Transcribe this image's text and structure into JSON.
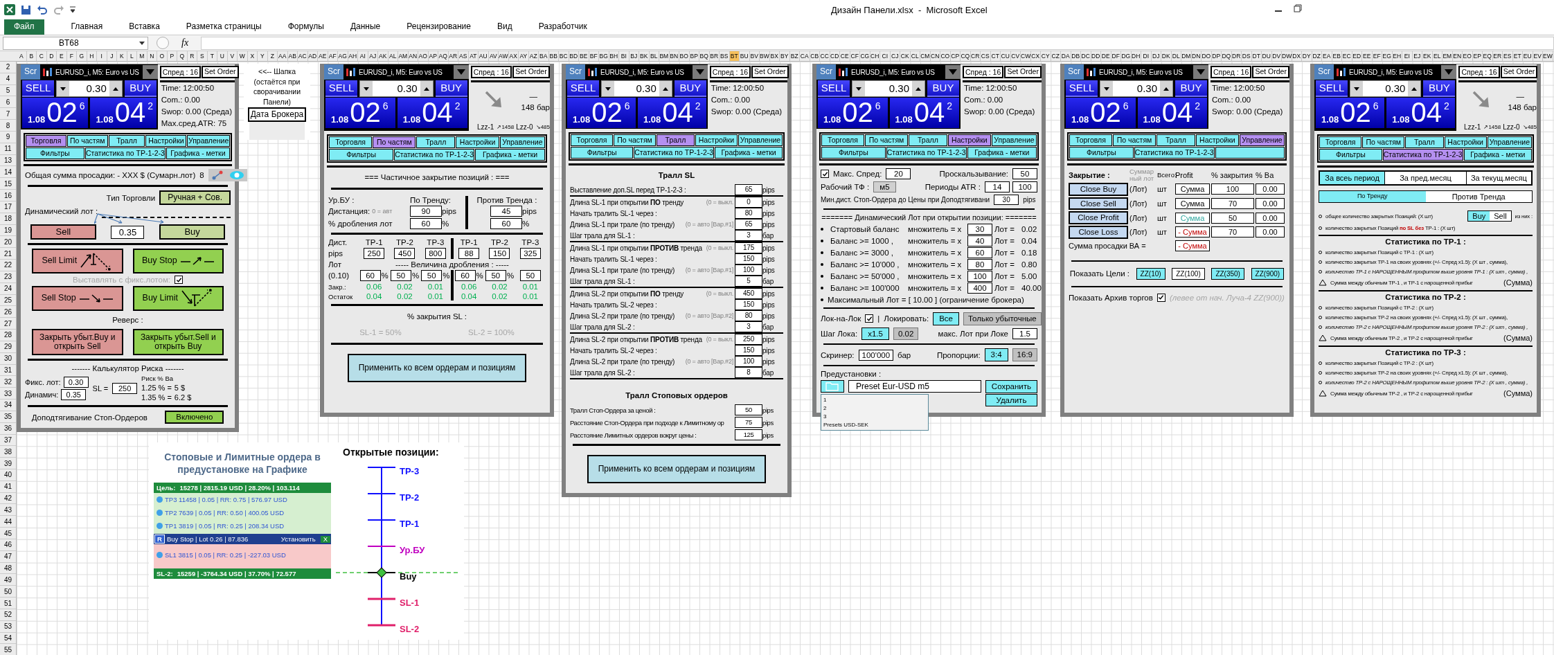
{
  "titlebar": {
    "title": "Дизайн Панели.xlsx  -  Microsoft Excel"
  },
  "ribbon": {
    "file_tab": "Файл",
    "tabs": [
      "Главная",
      "Вставка",
      "Разметка страницы",
      "Формулы",
      "Данные",
      "Рецензирование",
      "Вид",
      "Разработчик"
    ]
  },
  "formula_bar": {
    "name_box": "BT68",
    "fx": "fx"
  },
  "sheet": {
    "columns": [
      {
        "label": "A",
        "selected": false
      },
      {
        "label": "B",
        "selected": false
      },
      {
        "label": "C",
        "selected": false
      },
      {
        "label": "D",
        "selected": false
      },
      {
        "label": "E",
        "selected": false
      },
      {
        "label": "F",
        "selected": false
      },
      {
        "label": "G",
        "selected": false
      },
      {
        "label": "H",
        "selected": false
      },
      {
        "label": "I",
        "selected": false
      },
      {
        "label": "J",
        "selected": false
      },
      {
        "label": "K",
        "selected": false
      },
      {
        "label": "L",
        "selected": false
      },
      {
        "label": "M",
        "selected": false
      },
      {
        "label": "N",
        "selected": false
      },
      {
        "label": "O",
        "selected": false
      },
      {
        "label": "P",
        "selected": false
      },
      {
        "label": "Q",
        "selected": false
      },
      {
        "label": "R",
        "selected": false
      },
      {
        "label": "S",
        "selected": false
      },
      {
        "label": "T",
        "selected": false
      },
      {
        "label": "U",
        "selected": false
      },
      {
        "label": "V",
        "selected": false
      },
      {
        "label": "W",
        "selected": false
      },
      {
        "label": "X",
        "selected": false
      },
      {
        "label": "Y",
        "selected": false
      },
      {
        "label": "Z",
        "selected": false
      },
      {
        "label": "AA",
        "selected": false
      },
      {
        "label": "AB",
        "selected": false
      },
      {
        "label": "AC",
        "selected": false
      },
      {
        "label": "AD",
        "selected": false
      },
      {
        "label": "AE",
        "selected": false
      },
      {
        "label": "AF",
        "selected": false
      },
      {
        "label": "AG",
        "selected": false
      },
      {
        "label": "AH",
        "selected": false
      },
      {
        "label": "AI",
        "selected": false
      },
      {
        "label": "AJ",
        "selected": false
      },
      {
        "label": "AK",
        "selected": false
      },
      {
        "label": "AL",
        "selected": false
      },
      {
        "label": "AM",
        "selected": false
      },
      {
        "label": "AN",
        "selected": false
      },
      {
        "label": "AO",
        "selected": false
      },
      {
        "label": "AP",
        "selected": false
      },
      {
        "label": "AQ",
        "selected": false
      },
      {
        "label": "AR",
        "selected": false
      },
      {
        "label": "AS",
        "selected": false
      },
      {
        "label": "AT",
        "selected": false
      },
      {
        "label": "AU",
        "selected": false
      },
      {
        "label": "AV",
        "selected": false
      },
      {
        "label": "AW",
        "selected": false
      },
      {
        "label": "AX",
        "selected": false
      },
      {
        "label": "AY",
        "selected": false
      },
      {
        "label": "AZ",
        "selected": false
      },
      {
        "label": "BA",
        "selected": false
      },
      {
        "label": "BB",
        "selected": false
      },
      {
        "label": "BC",
        "selected": false
      },
      {
        "label": "BD",
        "selected": false
      },
      {
        "label": "BE",
        "selected": false
      },
      {
        "label": "BF",
        "selected": false
      },
      {
        "label": "BG",
        "selected": false
      },
      {
        "label": "BH",
        "selected": false
      },
      {
        "label": "BI",
        "selected": false
      },
      {
        "label": "BJ",
        "selected": false
      },
      {
        "label": "BK",
        "selected": false
      },
      {
        "label": "BL",
        "selected": false
      },
      {
        "label": "BM",
        "selected": false
      },
      {
        "label": "BN",
        "selected": false
      },
      {
        "label": "BO",
        "selected": false
      },
      {
        "label": "BP",
        "selected": false
      },
      {
        "label": "BQ",
        "selected": false
      },
      {
        "label": "BR",
        "selected": false
      },
      {
        "label": "BS",
        "selected": false
      },
      {
        "label": "BT",
        "selected": true
      },
      {
        "label": "BU",
        "selected": false
      },
      {
        "label": "BV",
        "selected": false
      },
      {
        "label": "BW",
        "selected": false
      },
      {
        "label": "BX",
        "selected": false
      },
      {
        "label": "BY",
        "selected": false
      },
      {
        "label": "BZ",
        "selected": false
      },
      {
        "label": "CA",
        "selected": false
      },
      {
        "label": "CB",
        "selected": false
      },
      {
        "label": "CC",
        "selected": false
      },
      {
        "label": "CD",
        "selected": false
      },
      {
        "label": "CE",
        "selected": false
      },
      {
        "label": "CF",
        "selected": false
      },
      {
        "label": "CG",
        "selected": false
      },
      {
        "label": "CH",
        "selected": false
      },
      {
        "label": "CI",
        "selected": false
      },
      {
        "label": "CJ",
        "selected": false
      },
      {
        "label": "CK",
        "selected": false
      },
      {
        "label": "CL",
        "selected": false
      },
      {
        "label": "CM",
        "selected": false
      },
      {
        "label": "CN",
        "selected": false
      },
      {
        "label": "CO",
        "selected": false
      },
      {
        "label": "CP",
        "selected": false
      },
      {
        "label": "CQ",
        "selected": false
      },
      {
        "label": "CR",
        "selected": false
      },
      {
        "label": "CS",
        "selected": false
      },
      {
        "label": "CT",
        "selected": false
      },
      {
        "label": "CU",
        "selected": false
      },
      {
        "label": "CV",
        "selected": false
      },
      {
        "label": "CW",
        "selected": false
      },
      {
        "label": "CX",
        "selected": false
      },
      {
        "label": "CY",
        "selected": false
      },
      {
        "label": "CZ",
        "selected": false
      },
      {
        "label": "DA",
        "selected": false
      },
      {
        "label": "DB",
        "selected": false
      },
      {
        "label": "DC",
        "selected": false
      },
      {
        "label": "DD",
        "selected": false
      },
      {
        "label": "DE",
        "selected": false
      },
      {
        "label": "DF",
        "selected": false
      },
      {
        "label": "DG",
        "selected": false
      },
      {
        "label": "DH",
        "selected": false
      },
      {
        "label": "DI",
        "selected": false
      },
      {
        "label": "DJ",
        "selected": false
      },
      {
        "label": "DK",
        "selected": false
      },
      {
        "label": "DL",
        "selected": false
      },
      {
        "label": "DM",
        "selected": false
      },
      {
        "label": "DN",
        "selected": false
      },
      {
        "label": "DO",
        "selected": false
      },
      {
        "label": "DP",
        "selected": false
      },
      {
        "label": "DQ",
        "selected": false
      },
      {
        "label": "DR",
        "selected": false
      },
      {
        "label": "DS",
        "selected": false
      },
      {
        "label": "DT",
        "selected": false
      },
      {
        "label": "DU",
        "selected": false
      },
      {
        "label": "DV",
        "selected": false
      },
      {
        "label": "DW",
        "selected": false
      },
      {
        "label": "DX",
        "selected": false
      },
      {
        "label": "DY",
        "selected": false
      },
      {
        "label": "DZ",
        "selected": false
      },
      {
        "label": "EA",
        "selected": false
      },
      {
        "label": "EB",
        "selected": false
      },
      {
        "label": "EC",
        "selected": false
      },
      {
        "label": "ED",
        "selected": false
      },
      {
        "label": "EE",
        "selected": false
      },
      {
        "label": "EF",
        "selected": false
      },
      {
        "label": "EG",
        "selected": false
      },
      {
        "label": "EH",
        "selected": false
      },
      {
        "label": "EI",
        "selected": false
      },
      {
        "label": "EJ",
        "selected": false
      },
      {
        "label": "EK",
        "selected": false
      },
      {
        "label": "EL",
        "selected": false
      },
      {
        "label": "EM",
        "selected": false
      },
      {
        "label": "EN",
        "selected": false
      },
      {
        "label": "EO",
        "selected": false
      },
      {
        "label": "EP",
        "selected": false
      },
      {
        "label": "EQ",
        "selected": false
      },
      {
        "label": "ER",
        "selected": false
      },
      {
        "label": "ES",
        "selected": false
      },
      {
        "label": "ET",
        "selected": false
      },
      {
        "label": "EU",
        "selected": false
      },
      {
        "label": "EV",
        "selected": false
      },
      {
        "label": "EW",
        "selected": false
      }
    ],
    "rows": [
      "2",
      "4",
      "5",
      "6",
      "7",
      "8",
      "9",
      "11",
      "13",
      "14",
      "15",
      "16",
      "17",
      "18",
      "19",
      "20",
      "21",
      "22",
      "23",
      "24",
      "25",
      "26",
      "27",
      "28",
      "29",
      "30",
      "31",
      "32",
      "33",
      "34",
      "35",
      "36",
      "37",
      "38",
      "39",
      "40",
      "41",
      "42",
      "43",
      "44",
      "45",
      "46",
      "47",
      "48",
      "49",
      "50",
      "51",
      "52",
      "53",
      "54",
      "55"
    ]
  },
  "note": {
    "text": "<<-- Шапка (остаётся при сворачивании Панели)",
    "button": "Дата Брокера"
  },
  "panels": [
    {
      "kind": "trading",
      "header": {
        "scr": "Scr",
        "symbol": "EURUSD_i, M5:  Euro vs US",
        "spread": "Спред : 16",
        "set_order": "Set Order",
        "sell": "SELL",
        "lot": "0.30",
        "buy": "BUY",
        "bid": {
          "big": "1.08",
          "main": "02",
          "pip": "6"
        },
        "ask": {
          "big": "1.08",
          "main": "04",
          "pip": "2"
        },
        "side": {
          "kind": "info",
          "lines": [
            "Time: 12:00:50",
            "Com.: 0.00",
            "Swop: 0.00 (Среда)",
            "Max.сред.ATR: 75"
          ]
        }
      },
      "tabs": [
        {
          "label": "Торговля",
          "selected": true
        },
        {
          "label": "По частям",
          "selected": false
        },
        {
          "label": "Тралл",
          "selected": false
        },
        {
          "label": "Настройки",
          "selected": false
        },
        {
          "label": "Управление",
          "selected": false
        },
        {
          "label": "Фильтры",
          "selected": false
        },
        {
          "label": "Статистика по TP-1-2-3",
          "selected": false
        },
        {
          "label": "Графика - метки",
          "selected": false
        }
      ],
      "drawdown": {
        "text": "Общая сумма просадки: - XXX $ (Сумарн.лот)",
        "count": "8"
      },
      "trade_type": {
        "label": "Тип Торговли",
        "value": "Ручная + Сов."
      },
      "dyn_lot": {
        "label": "Динамический лот :",
        "sell": "Sell",
        "lot": "0.35",
        "buy": "Buy"
      },
      "orders": {
        "sell_limit": "Sell Limit",
        "buy_stop": "Buy Stop",
        "fixed_label": "Выставлять с фикс.лотом:",
        "fixed_checked": true,
        "sell_stop": "Sell Stop",
        "buy_limit": "Buy Limit"
      },
      "reverse": {
        "label": "Реверс :",
        "close_buy": "Закрыть убыт.Buy и открыть Sell",
        "close_sell": "Закрыть убыт.Sell и открыть Buy"
      },
      "risk": {
        "title": "------- Калькулятор Риска -------",
        "fixed_label": "Фикс. лот:",
        "fixed": "0.30",
        "dyn_label": "Динамич:",
        "dyn": "0.35",
        "sl_label": "SL =",
        "sl": "250",
        "risk_label": "Риск % Ва",
        "rows": [
          {
            "pct": "1.25 % =",
            "amount": "5 $"
          },
          {
            "pct": "1.35 % =",
            "amount": "6.2 $"
          }
        ]
      },
      "stop_pull": {
        "label": "Доподтягивание Стоп-Ордеров",
        "button": "Включено",
        "on": true
      }
    },
    {
      "kind": "partial",
      "header": {
        "scr": "Scr",
        "symbol": "EURUSD_i, M5:  Euro vs US",
        "spread": "Спред : 16",
        "set_order": "Set Order",
        "sell": "SELL",
        "lot": "0.30",
        "buy": "BUY",
        "bid": {
          "big": "1.08",
          "main": "02",
          "pip": "6"
        },
        "ask": {
          "big": "1.08",
          "main": "04",
          "pip": "2"
        },
        "side": {
          "kind": "trend",
          "dash": "—",
          "bars": "148 бар",
          "lzz": [
            {
              "label": "Lzz-1",
              "value": "↗1458"
            },
            {
              "label": "Lzz-0",
              "value": "↘485"
            }
          ]
        }
      },
      "tabs": [
        {
          "label": "Торговля",
          "selected": false
        },
        {
          "label": "По частям",
          "selected": true
        },
        {
          "label": "Тралл",
          "selected": false
        },
        {
          "label": "Настройки",
          "selected": false
        },
        {
          "label": "Управление",
          "selected": false
        },
        {
          "label": "Фильтры",
          "selected": false
        },
        {
          "label": "Статистика по TP-1-2-3",
          "selected": false
        },
        {
          "label": "Графика - метки",
          "selected": false
        }
      ],
      "title": "=== Частичное закрытие позиций : ===",
      "be": {
        "label": "Ур.БУ :",
        "trend_title": "По Тренду:",
        "counter_title": "Против Тренда :",
        "rows": [
          {
            "label": "Дистанция:",
            "hint": "0 = авт",
            "trend": "90",
            "trend_unit": "pips",
            "counter": "45",
            "counter_unit": "pips"
          },
          {
            "label": "% дробления лот",
            "trend": "60",
            "trend_unit": "%",
            "counter": "60",
            "counter_unit": "%"
          }
        ]
      },
      "tp": {
        "dist_label": "Дист.",
        "pips_label": "pips",
        "lot_label": "Лот",
        "lot_base": "(0.10)",
        "split_title": "----- Величина дробления : -----",
        "closed_label": "Закр.:",
        "rest_label": "Остаток",
        "trend": [
          {
            "name": "TP-1",
            "dist": "250",
            "pct": "60",
            "unit": "%",
            "closed": "0.06",
            "rest": "0.04"
          },
          {
            "name": "TP-2",
            "dist": "450",
            "pct": "50",
            "unit": "%",
            "closed": "0.02",
            "rest": "0.02"
          },
          {
            "name": "TP-3",
            "dist": "800",
            "pct": "50",
            "unit": "%",
            "closed": "0.01",
            "rest": "0.01"
          }
        ],
        "counter": [
          {
            "name": "TP-1",
            "dist": "88",
            "pct": "60",
            "unit": "%",
            "closed": "0.06",
            "rest": "0.04"
          },
          {
            "name": "TP-2",
            "dist": "150",
            "pct": "50",
            "unit": "%",
            "closed": "0.02",
            "rest": "0.02"
          },
          {
            "name": "TP-3",
            "dist": "325",
            "pct": "50",
            "closed": "0.01",
            "rest": "0.01"
          }
        ]
      },
      "sl": {
        "title": "% закрытия SL :",
        "items": [
          {
            "label": "SL-1 = 50%",
            "disabled": true
          },
          {
            "label": "SL-2 = 100%",
            "disabled": true
          }
        ]
      },
      "apply": "Применить ко всем ордерам и позициям"
    },
    {
      "kind": "trail",
      "header": {
        "scr": "Scr",
        "symbol": "EURUSD_i, M5:  Euro vs US",
        "spread": "Спред : 16",
        "set_order": "Set Order",
        "sell": "SELL",
        "lot": "0.30",
        "buy": "BUY",
        "bid": {
          "big": "1.08",
          "main": "02",
          "pip": "6"
        },
        "ask": {
          "big": "1.08",
          "main": "04",
          "pip": "2"
        },
        "side": {
          "kind": "info",
          "lines": [
            "Time: 12:00:50",
            "Com.: 0.00",
            "Swop: 0.00 (Среда)"
          ]
        }
      },
      "tabs": [
        {
          "label": "Торговля",
          "selected": false
        },
        {
          "label": "По частям",
          "selected": false
        },
        {
          "label": "Тралл",
          "selected": true
        },
        {
          "label": "Настройки",
          "selected": false
        },
        {
          "label": "Управление",
          "selected": false
        },
        {
          "label": "Фильтры",
          "selected": false
        },
        {
          "label": "Статистика по TP-1-2-3",
          "selected": false
        },
        {
          "label": "Графика - метки",
          "selected": false
        }
      ],
      "title": "Тралл SL",
      "first": {
        "label": "Выставление доп.SL перед TP-1-2-3 :",
        "value": "65",
        "unit": "pips"
      },
      "groups": [
        [
          {
            "label": "Длина SL-1 при открытии **ПО** тренду",
            "hint": "(0 = выкл.",
            "value": "0",
            "unit": "pips"
          },
          {
            "label": "Начать тралить SL-1 через :",
            "value": "80",
            "unit": "pips"
          },
          {
            "label": "Длина SL-1 при трале (по тренду)",
            "hint": "(0 = авто [Вар.#1]",
            "value": "65",
            "unit": "pips"
          },
          {
            "label": "Шаг трала для SL-1 :",
            "value": "3",
            "unit": "бар"
          }
        ],
        [
          {
            "label": "Длина SL-1 при открытии **ПРОТИВ** тренда",
            "hint": "(0 = выкл.",
            "value": "175",
            "unit": "pips"
          },
          {
            "label": "Начать тралить SL-1 через :",
            "value": "150",
            "unit": "pips"
          },
          {
            "label": "Длина SL-1 при трале (по тренду)",
            "hint": "(0 = авто [Вар.#1]",
            "value": "100",
            "unit": "pips"
          },
          {
            "label": "Шаг трала для SL-1 :",
            "value": "5",
            "unit": "бар"
          }
        ],
        [
          {
            "label": "Длина SL-2 при открытии **ПО** тренду",
            "hint": "(0 = выкл.",
            "value": "450",
            "unit": "pips"
          },
          {
            "label": "Начать тралить SL-2 через :",
            "value": "150",
            "unit": "pips"
          },
          {
            "label": "Длина SL-2 при трале (по тренду)",
            "hint": "(0 = авто [Вар.#2]",
            "value": "80",
            "unit": "pips"
          },
          {
            "label": "Шаг трала для SL-2 :",
            "value": "3",
            "unit": "бар"
          }
        ],
        [
          {
            "label": "Длина SL-2 при открытии **ПРОТИВ** тренда",
            "hint": "(0 = выкл.",
            "value": "250",
            "unit": "pips"
          },
          {
            "label": "Начать тралить SL-2 через :",
            "value": "150",
            "unit": "pips"
          },
          {
            "label": "Длина SL-2 при трале (по тренду)",
            "hint": "(0 = авто [Вар.#2]",
            "value": "100",
            "unit": "pips"
          },
          {
            "label": "Шаг трала для SL-2 :",
            "value": "8",
            "unit": "бар"
          }
        ]
      ],
      "stop_title": "Тралл Стоповых ордеров",
      "stop_rows": [
        {
          "label": "Тралл Стоп-Ордера  за ценой :",
          "value": "50",
          "unit": "pips"
        },
        {
          "label": "Расстояние Стоп-Ордера при подходе к Лимитному ор",
          "value": "75",
          "unit": "pips"
        },
        {
          "label": "Расстояние Лимитных ордеров вокруг цены :",
          "value": "125",
          "unit": "pips"
        }
      ],
      "apply": "Применить ко всем ордерам и позициям"
    },
    {
      "kind": "settings",
      "header": {
        "scr": "Scr",
        "symbol": "EURUSD_i, M5:  Euro vs US",
        "spread": "Спред : 16",
        "set_order": "Set Order",
        "sell": "SELL",
        "lot": "0.30",
        "buy": "BUY",
        "bid": {
          "big": "1.08",
          "main": "02",
          "pip": "6"
        },
        "ask": {
          "big": "1.08",
          "main": "04",
          "pip": "2"
        },
        "side": {
          "kind": "info",
          "lines": [
            "Time: 12:00:50",
            "Com.: 0.00",
            "Swop: 0.00 (Среда)"
          ]
        }
      },
      "tabs": [
        {
          "label": "Торговля",
          "selected": false
        },
        {
          "label": "По частям",
          "selected": false
        },
        {
          "label": "Тралл",
          "selected": false
        },
        {
          "label": "Настройки",
          "selected": true
        },
        {
          "label": "Управление",
          "selected": false
        },
        {
          "label": "Фильтры",
          "selected": false
        },
        {
          "label": "Статистика по TP-1-2-3",
          "selected": false
        },
        {
          "label": "Графика - метки",
          "selected": false
        }
      ],
      "max_spread": {
        "checked": true,
        "label": "Макс. Спред:",
        "value": "20"
      },
      "slippage": {
        "label": "Проскальзывание:",
        "value": "50"
      },
      "tf": {
        "label": "Рабочий ТФ :",
        "value": "м5"
      },
      "atr": {
        "label": "Периоды ATR :",
        "values": [
          "14",
          "100"
        ]
      },
      "min_dist": {
        "label": "Мин.дист. Стоп-Ордера до Цены при Доподтягивани",
        "value": "30",
        "unit": "pips"
      },
      "dyn_title": "======= Динамический Лот при открытии позиции: =======",
      "dyn_rows": [
        {
          "label": "Стартовый баланс",
          "mult": "множитель = x",
          "value": "30",
          "lot_label": "Лот =",
          "lot": "0.02"
        },
        {
          "label": "Баланс >= 1000 ,",
          "mult": "множитель = x",
          "value": "40",
          "lot_label": "Лот =",
          "lot": "0.04"
        },
        {
          "label": "Баланс >= 3000 ,",
          "mult": "множитель = x",
          "value": "60",
          "lot_label": "Лот =",
          "lot": "0.18"
        },
        {
          "label": "Баланс >= 10'000 ,",
          "mult": "множитель = x",
          "value": "80",
          "lot_label": "Лот =",
          "lot": "0.80"
        },
        {
          "label": "Баланс >= 50'000 ,",
          "mult": "множитель = x",
          "value": "100",
          "lot_label": "Лот =",
          "lot": "5.00"
        },
        {
          "label": "Баланс >= 100'000",
          "mult": "множитель = x",
          "value": "400",
          "lot_label": "Лот =",
          "lot": "40.00"
        }
      ],
      "max_lot": "Максимальный Лот = [ 10.00 ] (ограничение брокера)",
      "lock": {
        "label": "Лок-на-Лок",
        "checked": true,
        "sep": "|",
        "mode_label": "Локировать:",
        "modes": [
          {
            "label": "Все",
            "selected": true
          },
          {
            "label": "Только убыточные",
            "selected": false
          }
        ],
        "step_label": "Шаг Лока:",
        "steps": [
          {
            "label": "x1.5",
            "selected": true
          },
          {
            "label": "0.02",
            "selected": false
          }
        ],
        "max_label": "макс. Лот при Локе",
        "max": "1.5"
      },
      "screener": {
        "label": "Скринер:",
        "value": "100'000",
        "unit": "бар",
        "ratio_label": "Пропорции:",
        "ratios": [
          {
            "label": "3:4",
            "selected": true
          },
          {
            "label": "16:9",
            "selected": false
          }
        ]
      },
      "presets": {
        "label": "Предустановки :",
        "value": "Preset Eur-USD m5",
        "save": "Сохранить",
        "delete": "Удалить",
        "menu": [
          "1",
          "2",
          "3",
          "Presets USD-SEK"
        ]
      }
    },
    {
      "kind": "management",
      "header": {
        "scr": "Scr",
        "symbol": "EURUSD_i, M5:  Euro vs US",
        "spread": "Спред : 16",
        "set_order": "Set Order",
        "sell": "SELL",
        "lot": "0.30",
        "buy": "BUY",
        "bid": {
          "big": "1.08",
          "main": "02",
          "pip": "6"
        },
        "ask": {
          "big": "1.08",
          "main": "04",
          "pip": "2"
        },
        "side": {
          "kind": "info",
          "lines": [
            "Time: 12:00:50",
            "Com.: 0.00",
            "Swop: 0.00 (Среда)"
          ]
        }
      },
      "tabs": [
        {
          "label": "Торговля",
          "selected": false
        },
        {
          "label": "По частям",
          "selected": false
        },
        {
          "label": "Тралл",
          "selected": false
        },
        {
          "label": "Настройки",
          "selected": false
        },
        {
          "label": "Управление",
          "selected": true
        },
        {
          "label": "Фильтры",
          "selected": false
        },
        {
          "label": "Статистика по TP-1-2-3",
          "selected": false
        },
        {
          "selected": false
        }
      ],
      "columns": {
        "title": "Закрытие :",
        "sum_lot": "Суммар ный лот",
        "total": "Всего:",
        "profit": "Profit",
        "pct": "% закрытия",
        "ba": "% Ва"
      },
      "rows": [
        {
          "button": "Close Buy",
          "lot": "(Лот)",
          "unit": "шт",
          "sum": "Сумма",
          "kind": "plain",
          "pct": "100",
          "ba": "0.00"
        },
        {
          "button": "Close Sell",
          "lot": "(Лот)",
          "unit": "шт",
          "sum": "Сумма",
          "kind": "plain",
          "pct": "70",
          "ba": "0.00"
        },
        {
          "button": "Close Profit",
          "lot": "(Лот)",
          "unit": "шт",
          "sum": "Сумма",
          "kind": "profit",
          "pct": "50",
          "ba": "0.00"
        },
        {
          "button": "Close Loss",
          "lot": "(Лот)",
          "unit": "шт",
          "sum": "- Сумма",
          "kind": "loss",
          "pct": "70",
          "ba": "0.00"
        }
      ],
      "drawdown": {
        "label": "Сумма просадки ВА =",
        "sum": "- Сумма",
        "kind": "loss"
      },
      "targets": {
        "label": "Показать Цели :",
        "items": [
          {
            "label": "ZZ(10)",
            "on": true
          },
          {
            "label": "ZZ(100)",
            "on": false
          },
          {
            "label": "ZZ(350)",
            "on": true
          },
          {
            "label": "ZZ(900)",
            "on": true
          }
        ]
      },
      "archive": {
        "label": "Показать Архив торгов",
        "checked": true,
        "hint": "(левее от нач. Луча-4 ZZ(900))"
      }
    },
    {
      "kind": "stats",
      "header": {
        "scr": "Scr",
        "symbol": "EURUSD_i, M5:  Euro vs US",
        "spread": "Спред : 16",
        "set_order": "Set Order",
        "sell": "SELL",
        "lot": "0.30",
        "buy": "BUY",
        "bid": {
          "big": "1.08",
          "main": "02",
          "pip": "6"
        },
        "ask": {
          "big": "1.08",
          "main": "04",
          "pip": "2"
        },
        "side": {
          "kind": "trend",
          "dash": "—",
          "bars": "148 бар",
          "lzz": [
            {
              "label": "Lzz-1",
              "value": "↗1458"
            },
            {
              "label": "Lzz-0",
              "value": "↘485"
            }
          ]
        }
      },
      "tabs": [
        {
          "label": "Торговля",
          "selected": false
        },
        {
          "label": "По частям",
          "selected": false
        },
        {
          "label": "Тралл",
          "selected": false
        },
        {
          "label": "Настройки",
          "selected": false
        },
        {
          "label": "Управление",
          "selected": false
        },
        {
          "label": "Фильтры",
          "selected": false
        },
        {
          "label": "Статистика по TP-1-2-3",
          "selected": true
        },
        {
          "label": "Графика - метки",
          "selected": false
        }
      ],
      "periods": [
        {
          "label": "За всеь период",
          "selected": true
        },
        {
          "label": "За пред.месяц",
          "selected": false
        },
        {
          "label": "За текущ.месяц",
          "selected": false
        }
      ],
      "trend": [
        {
          "label": "По Тренду",
          "selected": true
        },
        {
          "label": "Против Тренда",
          "selected": false
        }
      ],
      "total": {
        "text": "общее количество закрытых Позиций: (X шт)",
        "options": [
          {
            "label": "Buy",
            "selected": true
          },
          {
            "label": "Sell",
            "selected": false
          }
        ],
        "suffix": "из них :"
      },
      "sl_line": "количество закрытых Позиций **по SL** **без** TP-1 : (X шт)",
      "sections": [
        {
          "title": "Статистика по TP-1 :",
          "lines": [
            {
              "kind": "bullet",
              "text": "количество закрытых Позиций с TP-1 : (X шт)"
            },
            {
              "kind": "bullet",
              "text": "количество закрытых TP-1 на своих уровнях (+/- Спред x1.5): (X шт , сумма),"
            },
            {
              "kind": "emph",
              "text": "количество TP-1 с НАРОЩЕННЫМ профитом выше уровня TP-1 : (X шт , сумма) ,"
            },
            {
              "kind": "delta",
              "text": "Сумма между обычным TP-1 , и TP-1 с нарощенной прибыг",
              "value": "(Сумма)"
            }
          ]
        },
        {
          "title": "Статистика по TP-2 :",
          "lines": [
            {
              "kind": "bullet",
              "text": "количество закрытых Позиций с TP-2 : (X шт)"
            },
            {
              "kind": "bullet",
              "text": "количество закрытых TP-2 на своих уровнях (+/- Спред x1.5): (X шт , сумма),"
            },
            {
              "kind": "emph",
              "text": "количество TP-2 с НАРОЩЕННЫМ профитом выше уровня TP-2 : (X шт , сумма) ,"
            },
            {
              "kind": "delta",
              "text": "Сумма между обычным TP-2 , и TP-2 с нарощенной прибыг",
              "value": "(Сумма)"
            }
          ]
        },
        {
          "title": "Статистика по TP-3 :",
          "lines": [
            {
              "kind": "bullet",
              "text": "количество закрытых Позиций с TP-2 : (X шт)"
            },
            {
              "kind": "bullet",
              "text": "количество закрытых TP-2 на своих уровнях (+/- Спред x1.5): (X шт , сумма),"
            },
            {
              "kind": "emph",
              "text": "количество TP-2 с НАРОЩЕННЫМ профитом выше уровня TP-2 : (X шт , сумма) ,"
            },
            {
              "kind": "delta",
              "text": "Сумма между обычным TP-2 , и TP-2 с нарощенной прибыг",
              "value": "(Сумма)"
            }
          ]
        }
      ]
    }
  ],
  "diagram": {
    "title": "Стоповые и Лимитные ордера в предустановке на Графике",
    "target": {
      "label": "Цель:",
      "text": "15278 | 2815.19 USD | 28.20% | 103.114"
    },
    "tps": [
      "TP3 11458 | 0.05 | RR: 0.75 | 576.97 USD",
      "TP2 7639 | 0.05 | RR: 0.50 | 400.05 USD",
      "TP1 3819 | 0.05 | RR: 0.25 | 208.34 USD"
    ],
    "order": {
      "badge": "R",
      "text": "Buy Stop | Lot 0.26 | 87.836",
      "set": "Установить",
      "close": "X"
    },
    "sls": [
      "SL1 3815 | 0.05 | RR: 0.25 | -227.03 USD"
    ],
    "stop": {
      "label": "SL-2:",
      "text": "15259 | -3764.34 USD | 37.70% | 72.577"
    },
    "positions_title": "Открытые позиции:",
    "levels": [
      {
        "label": "ТР-3",
        "kind": "tp"
      },
      {
        "label": "ТР-2",
        "kind": "tp"
      },
      {
        "label": "ТР-1",
        "kind": "tp"
      },
      {
        "label": "Ур.БУ",
        "kind": "be"
      },
      {
        "label": "Buy",
        "kind": "entry"
      },
      {
        "label": "SL-1",
        "kind": "sl"
      },
      {
        "label": "SL-2",
        "kind": "sl"
      }
    ]
  }
}
